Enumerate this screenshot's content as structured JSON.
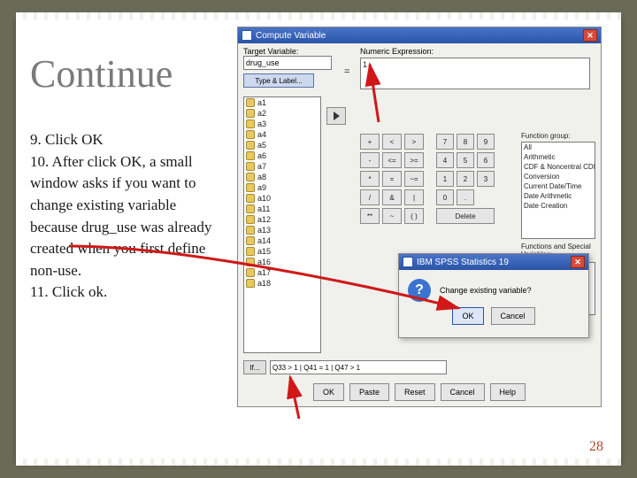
{
  "slide": {
    "title": "Continue",
    "body": "9. Click OK\n10. After click OK, a small window asks if you want to change existing variable because drug_use was already created when you first define non-use.\n11. Click ok.",
    "page_number": "28"
  },
  "compute": {
    "title": "Compute Variable",
    "target_label": "Target Variable:",
    "target_value": "drug_use",
    "type_label_btn": "Type & Label...",
    "numexpr_label": "Numeric Expression:",
    "numexpr_value": "1",
    "variables": [
      "a1",
      "a2",
      "a3",
      "a4",
      "a5",
      "a6",
      "a7",
      "a8",
      "a9",
      "a10",
      "a11",
      "a12",
      "a13",
      "a14",
      "a15",
      "a16",
      "a17",
      "a18"
    ],
    "calc_rows": [
      [
        "+",
        "<",
        ">",
        "",
        "7",
        "8",
        "9"
      ],
      [
        "-",
        "<=",
        ">=",
        "",
        "4",
        "5",
        "6"
      ],
      [
        "*",
        "=",
        "~=",
        "",
        "1",
        "2",
        "3"
      ],
      [
        "/",
        "&",
        "|",
        "",
        "0",
        ".",
        ""
      ],
      [
        "**",
        "~",
        "( )",
        "",
        "Delete",
        "",
        ""
      ]
    ],
    "func_group_label": "Function group:",
    "func_groups": [
      "All",
      "Arithmetic",
      "CDF & Noncentral CDF",
      "Conversion",
      "Current Date/Time",
      "Date Arithmetic",
      "Date Creation"
    ],
    "func_special_label": "Functions and Special Variables:",
    "if_btn": "If...",
    "if_condition": "Q33 > 1 | Q41 = 1 | Q47 > 1",
    "buttons": {
      "ok": "OK",
      "paste": "Paste",
      "reset": "Reset",
      "cancel": "Cancel",
      "help": "Help"
    }
  },
  "confirm": {
    "title": "IBM SPSS Statistics 19",
    "message": "Change existing variable?",
    "ok": "OK",
    "cancel": "Cancel"
  }
}
